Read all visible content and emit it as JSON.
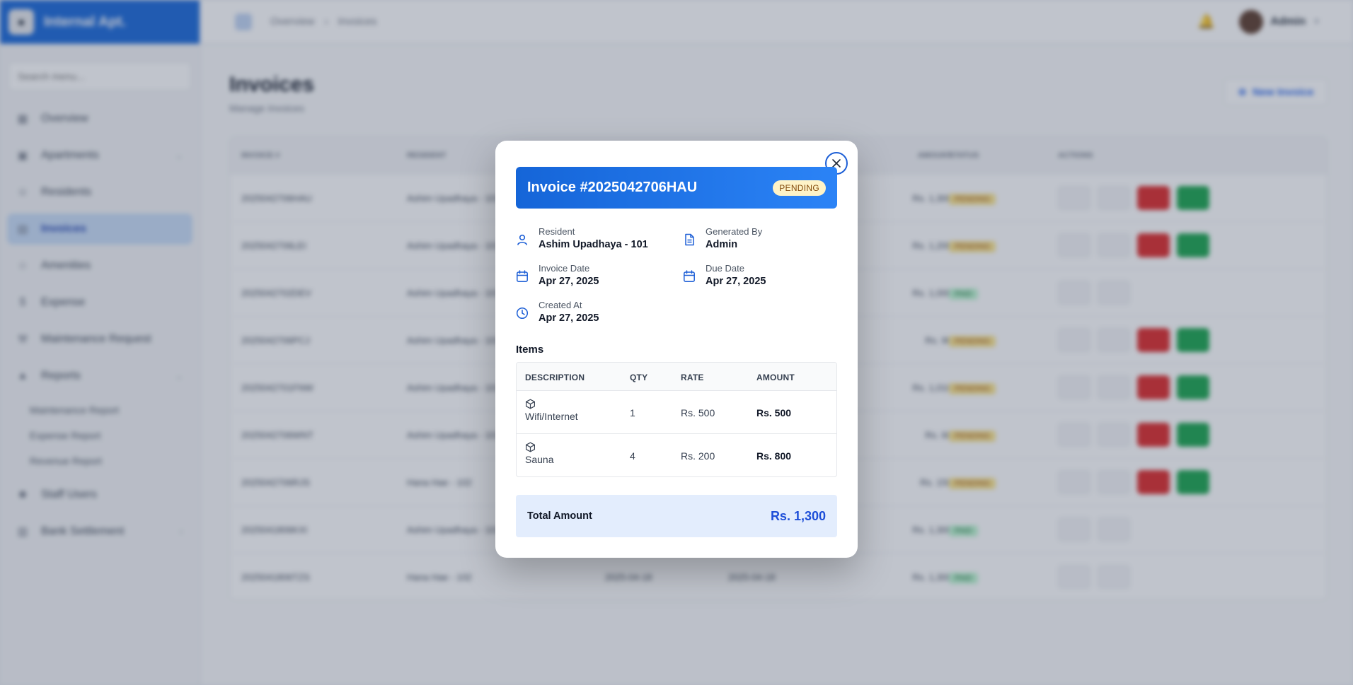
{
  "background": {
    "brand": "Internal Apt.",
    "search_placeholder": "Search menu...",
    "nav": [
      {
        "label": "Overview",
        "icon": "grid-icon"
      },
      {
        "label": "Apartments",
        "icon": "building-icon"
      },
      {
        "label": "Residents",
        "icon": "users-icon"
      },
      {
        "label": "Invoices",
        "icon": "file-icon"
      },
      {
        "label": "Amenities",
        "icon": "star-icon"
      },
      {
        "label": "Expense",
        "icon": "dollar-icon"
      },
      {
        "label": "Maintenance Request",
        "icon": "wrench-icon"
      },
      {
        "label": "Reports",
        "icon": "chart-icon"
      }
    ],
    "report_subitems": [
      "Maintenance Report",
      "Expense Report",
      "Revenue Report"
    ],
    "nav_bottom": [
      {
        "label": "Staff Users",
        "icon": "user-plus-icon"
      },
      {
        "label": "Bank Settlement",
        "icon": "bank-icon"
      }
    ],
    "breadcrumb": [
      "Overview",
      "Invoices"
    ],
    "user_name": "Admin",
    "page_title": "Invoices",
    "page_subtitle": "Manage Invoices",
    "new_button": "New Invoice",
    "columns": [
      "INVOICE #",
      "RESIDENT",
      "",
      "",
      "AMOUNT",
      "STATUS",
      "ACTIONS"
    ],
    "rows": [
      {
        "id": "2025042706HAU",
        "resident": "Ashim Upadhaya - 101",
        "amount": "Rs. 1,300",
        "status": "PENDING"
      },
      {
        "id": "2025042706LEI",
        "resident": "Ashim Upadhaya - 101",
        "amount": "Rs. 1,200",
        "status": "PENDING"
      },
      {
        "id": "2025042702DEV",
        "resident": "Ashim Upadhaya - 101",
        "amount": "Rs. 1,000",
        "status": "PAID"
      },
      {
        "id": "2025042706PCJ",
        "resident": "Ashim Upadhaya - 101",
        "amount": "Rs. 90",
        "status": "PENDING"
      },
      {
        "id": "2025042701FNW",
        "resident": "Ashim Upadhaya - 101",
        "amount": "Rs. 1,010",
        "status": "PENDING"
      },
      {
        "id": "2025042706WNT",
        "resident": "Ashim Upadhaya - 101",
        "amount": "Rs. 60",
        "status": "PENDING"
      },
      {
        "id": "2025042706RJS",
        "resident": "Hana Hae - 102",
        "amount": "Rs. 150",
        "status": "PENDING"
      },
      {
        "id": "2025041806KXI",
        "resident": "Ashim Upadhaya - 101",
        "amount": "Rs. 1,300",
        "status": "PAID"
      },
      {
        "id": "2025041806TZS",
        "resident": "Hana Hae - 102",
        "date1": "2025-04-18",
        "date2": "2025-04-18",
        "amount": "Rs. 1,300",
        "status": "PAID"
      }
    ]
  },
  "modal": {
    "title": "Invoice #2025042706HAU",
    "status": "PENDING",
    "fields": {
      "resident": {
        "label": "Resident",
        "value": "Ashim Upadhaya - 101"
      },
      "generated_by": {
        "label": "Generated By",
        "value": "Admin"
      },
      "invoice_date": {
        "label": "Invoice Date",
        "value": "Apr 27, 2025"
      },
      "due_date": {
        "label": "Due Date",
        "value": "Apr 27, 2025"
      },
      "created_at": {
        "label": "Created At",
        "value": "Apr 27, 2025"
      }
    },
    "items_title": "Items",
    "items_columns": [
      "DESCRIPTION",
      "QTY",
      "RATE",
      "AMOUNT"
    ],
    "items": [
      {
        "description": "Wifi/Internet",
        "qty": "1",
        "rate": "Rs. 500",
        "amount": "Rs. 500"
      },
      {
        "description": "Sauna",
        "qty": "4",
        "rate": "Rs. 200",
        "amount": "Rs. 800"
      }
    ],
    "total_label": "Total Amount",
    "total_value": "Rs. 1,300"
  },
  "colors": {
    "primary": "#1565d8",
    "pending_bg": "#fef3c7",
    "total_bg": "#e3edfd",
    "total_text": "#1d4ed8"
  }
}
